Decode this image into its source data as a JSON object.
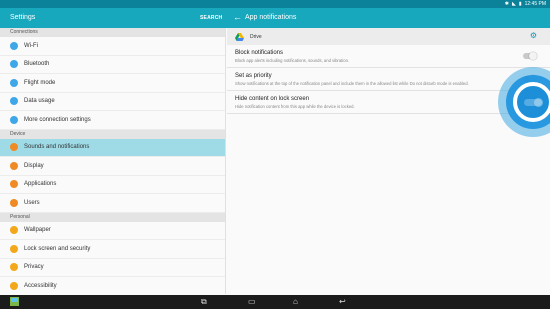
{
  "status_bar": {
    "time": "12:45 PM",
    "icons": [
      "bluetooth-icon",
      "wifi-icon",
      "battery-icon"
    ]
  },
  "colors": {
    "status_bar": "#0b8299",
    "app_bar": "#17a8bd",
    "selected": "#9fdbe7",
    "accent": "#1d8fd9"
  },
  "left": {
    "title": "Settings",
    "search_label": "SEARCH",
    "sections": [
      {
        "header": "Connections",
        "items": [
          {
            "label": "Wi-Fi",
            "icon": "wifi-icon",
            "color": "#3fa7e8"
          },
          {
            "label": "Bluetooth",
            "icon": "bluetooth-icon",
            "color": "#3fa7e8"
          },
          {
            "label": "Flight mode",
            "icon": "airplane-icon",
            "color": "#3fa7e8"
          },
          {
            "label": "Data usage",
            "icon": "data-usage-icon",
            "color": "#3fa7e8"
          },
          {
            "label": "More connection settings",
            "icon": "more-connections-icon",
            "color": "#3fa7e8"
          }
        ]
      },
      {
        "header": "Device",
        "items": [
          {
            "label": "Sounds and notifications",
            "icon": "sound-icon",
            "color": "#f08a24",
            "selected": true
          },
          {
            "label": "Display",
            "icon": "display-icon",
            "color": "#f08a24"
          },
          {
            "label": "Applications",
            "icon": "applications-icon",
            "color": "#f08a24"
          },
          {
            "label": "Users",
            "icon": "users-icon",
            "color": "#f08a24"
          }
        ]
      },
      {
        "header": "Personal",
        "items": [
          {
            "label": "Wallpaper",
            "icon": "wallpaper-icon",
            "color": "#f3a71a"
          },
          {
            "label": "Lock screen and security",
            "icon": "lock-icon",
            "color": "#f3a71a"
          },
          {
            "label": "Privacy",
            "icon": "privacy-icon",
            "color": "#f3a71a"
          },
          {
            "label": "Accessibility",
            "icon": "accessibility-icon",
            "color": "#f3a71a"
          }
        ]
      }
    ]
  },
  "right": {
    "title": "App notifications",
    "app_name": "Drive",
    "prefs": [
      {
        "title": "Block notifications",
        "summary": "Block app alerts including notifications, sounds, and vibration."
      },
      {
        "title": "Set as priority",
        "summary": "Show notifications at the top of the notification panel and include them in the allowed list while Do not disturb mode is enabled."
      },
      {
        "title": "Hide content on lock screen",
        "summary": "Hide notification content from this app while the device is locked."
      }
    ]
  },
  "nav": {
    "icons": [
      "gallery-icon",
      "recent-apps-icon",
      "screen-icon",
      "home-icon",
      "back-icon"
    ]
  }
}
